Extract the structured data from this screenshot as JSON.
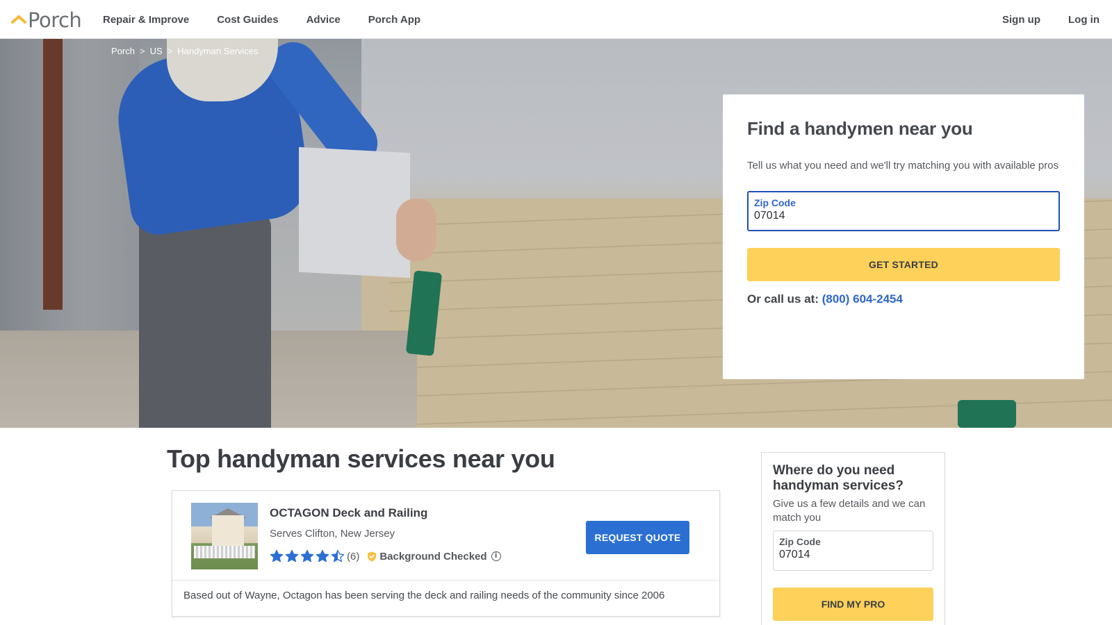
{
  "header": {
    "logo_text": "Porch",
    "logo_icon": "porch-roof-icon",
    "brand_color": "#f8b93a",
    "nav": [
      "Repair & Improve",
      "Cost Guides",
      "Advice",
      "Porch App"
    ],
    "signup_label": "Sign up",
    "login_label": "Log in"
  },
  "breadcrumb": {
    "items": [
      "Porch",
      "US",
      "Handyman Services"
    ],
    "separator": ">"
  },
  "find_card": {
    "title": "Find a handymen near you",
    "subtitle": "Tell us what you need and we'll try matching you with available pros",
    "zip_label": "Zip Code",
    "zip_value": "07014",
    "cta_label": "GET STARTED",
    "call_prefix": "Or call us at:",
    "phone": "(800) 604-2454",
    "cta_color": "#fdd15a",
    "link_color": "#2f66c6"
  },
  "main": {
    "title": "Top handyman services near you"
  },
  "pro": {
    "name": "OCTAGON Deck and Railing",
    "serves": "Serves Clifton, New Jersey",
    "rating": 4.5,
    "rating_max": 5,
    "review_count": "(6)",
    "badge": "Background Checked",
    "badge_icon": "shield-check-icon",
    "request_label": "REQUEST QUOTE",
    "request_color": "#2b6fd3",
    "description": "Based out of Wayne, Octagon has been serving the deck and railing needs of the community since 2006"
  },
  "side": {
    "title": "Where do you need handyman services?",
    "subtitle": "Give us a few details and we can match you",
    "zip_label": "Zip Code",
    "zip_value": "07014",
    "cta_label": "FIND MY PRO"
  }
}
